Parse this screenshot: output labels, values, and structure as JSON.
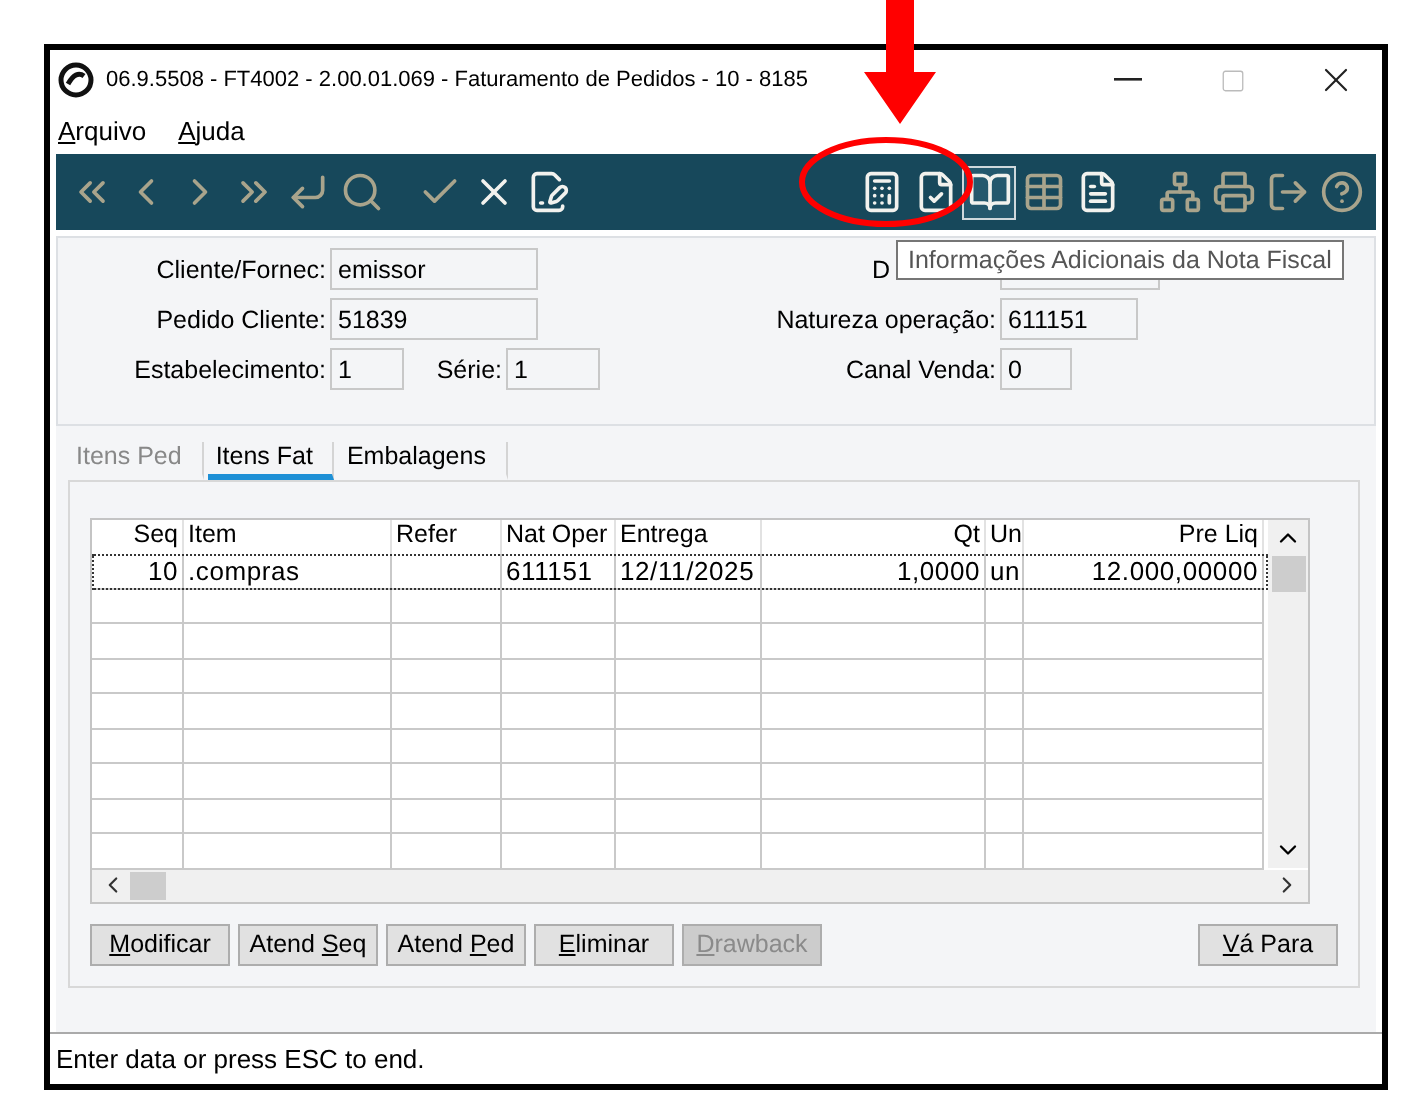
{
  "window": {
    "title": "06.9.5508 - FT4002 - 2.00.01.069 - Faturamento de Pedidos - 10 - 8185"
  },
  "menu": [
    {
      "key": "A",
      "post": "rquivo"
    },
    {
      "key": "A",
      "post": "juda"
    }
  ],
  "toolbar": [
    {
      "disabled": true,
      "selected": false
    },
    {
      "disabled": true,
      "selected": false
    },
    {
      "disabled": true,
      "selected": false
    },
    {
      "disabled": true,
      "selected": false
    },
    {
      "disabled": true,
      "selected": false
    },
    {
      "disabled": true,
      "selected": false
    },
    {
      "disabled": true,
      "selected": false
    },
    {
      "disabled": false,
      "selected": false
    },
    {
      "disabled": false,
      "selected": false
    },
    {
      "disabled": false,
      "selected": false
    },
    {
      "disabled": false,
      "selected": false
    },
    {
      "disabled": false,
      "selected": true
    },
    {
      "disabled": true,
      "selected": false
    },
    {
      "disabled": false,
      "selected": false
    },
    {
      "disabled": true,
      "selected": false
    },
    {
      "disabled": true,
      "selected": false
    },
    {
      "disabled": true,
      "selected": false
    },
    {
      "disabled": true,
      "selected": false
    }
  ],
  "tooltip": "Informações Adicionais da Nota Fiscal",
  "form": {
    "cliente": {
      "label": "Cliente/Fornec:",
      "value": "emissor"
    },
    "pedido": {
      "label": "Pedido Cliente:",
      "value": "51839"
    },
    "estabelecimento": {
      "label": "Estabelecimento:",
      "value": "1"
    },
    "serie": {
      "label": "Série:",
      "value": "1"
    },
    "covered": {
      "label": "D"
    },
    "natureza": {
      "label": "Natureza operação:",
      "value": "611151"
    },
    "canal": {
      "label": "Canal Venda:",
      "value": "0"
    }
  },
  "tabs": [
    {
      "label": "Itens Ped",
      "selected": false,
      "disabled": true
    },
    {
      "label": "Itens Fat",
      "selected": true,
      "disabled": false
    },
    {
      "label": "Embalagens",
      "selected": false,
      "disabled": false
    }
  ],
  "table": {
    "columns": [
      "Seq",
      "Item",
      "Refer",
      "Nat Oper",
      "Entrega",
      "Qt",
      "Un",
      "Pre Liq"
    ],
    "rows": [
      {
        "selected": true,
        "cells": [
          "10",
          ".compras",
          null,
          "611151",
          "12/11/2025",
          "1,0000",
          "un",
          "12.000,00000"
        ]
      }
    ]
  },
  "buttons": [
    {
      "key": "M",
      "post": "odificar",
      "disabled": false
    },
    {
      "pre": "Atend ",
      "key": "S",
      "post": "eq",
      "disabled": false
    },
    {
      "pre": "Atend ",
      "key": "P",
      "post": "ed",
      "disabled": false
    },
    {
      "key": "E",
      "post": "liminar",
      "disabled": false
    },
    {
      "key": "D",
      "post": "rawback",
      "disabled": true
    },
    {
      "key": "V",
      "post": "á Para",
      "disabled": false
    }
  ],
  "status_bar": "Enter data or press ESC to end."
}
